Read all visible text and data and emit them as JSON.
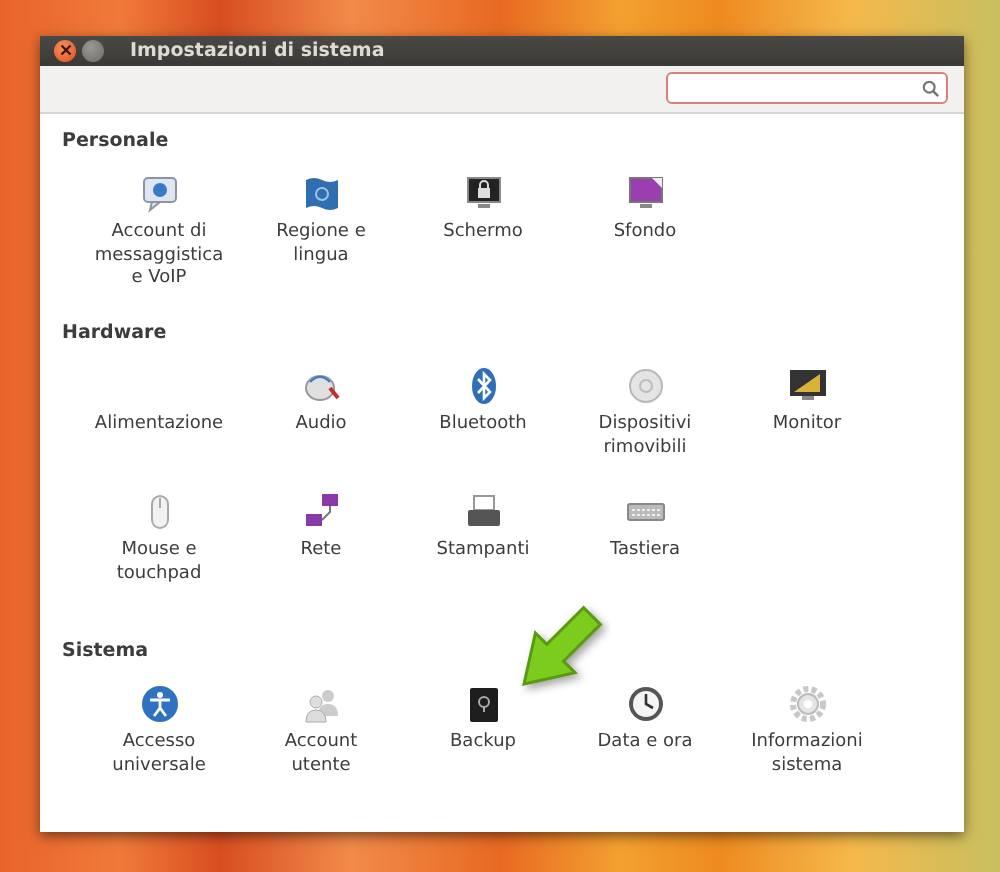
{
  "window": {
    "title": "Impostazioni di sistema"
  },
  "sections": [
    {
      "title": "Personale",
      "items": [
        {
          "label": "Account di\nmessaggistica\ne VoIP",
          "kind": "chat"
        },
        {
          "label": "Regione e\nlingua",
          "kind": "flag"
        },
        {
          "label": "Schermo",
          "kind": "lock"
        },
        {
          "label": "Sfondo",
          "kind": "wallpaper"
        }
      ]
    },
    {
      "title": "Hardware",
      "items": [
        {
          "label": "Alimentazione"
        },
        {
          "label": "Audio",
          "kind": "speaker"
        },
        {
          "label": "Bluetooth",
          "kind": "bluetooth"
        },
        {
          "label": "Dispositivi\nrimovibili",
          "kind": "disc"
        },
        {
          "label": "Monitor",
          "kind": "monitor"
        },
        {
          "label": "Mouse e\ntouchpad",
          "kind": "mouse"
        },
        {
          "label": "Rete",
          "kind": "network"
        },
        {
          "label": "Stampanti",
          "kind": "printer"
        },
        {
          "label": "Tastiera",
          "kind": "keyboard"
        }
      ]
    },
    {
      "title": "Sistema",
      "items": [
        {
          "label": "Accesso\nuniversale",
          "kind": "accessibility"
        },
        {
          "label": "Account\nutente",
          "kind": "users"
        },
        {
          "label": "Backup",
          "kind": "safe"
        },
        {
          "label": "Data e ora",
          "kind": "clock"
        },
        {
          "label": "Informazioni\nsistema",
          "kind": "gear"
        }
      ]
    }
  ]
}
